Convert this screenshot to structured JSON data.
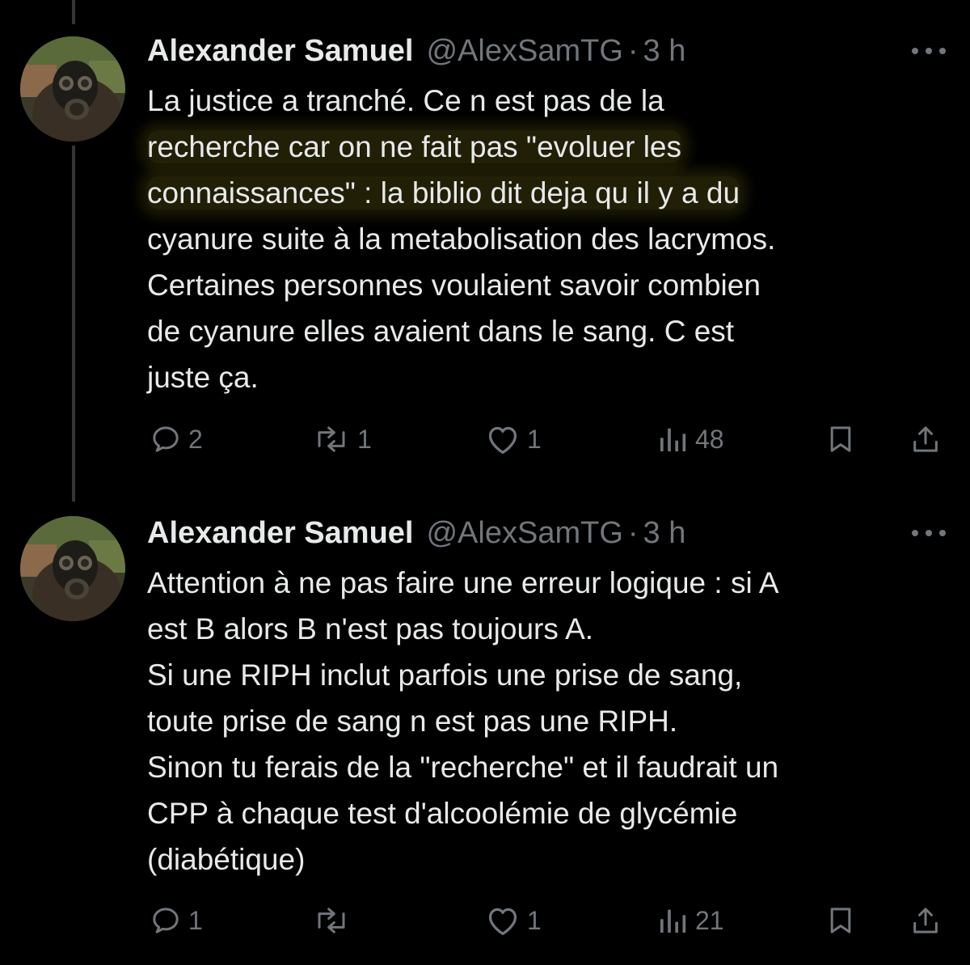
{
  "tweets": [
    {
      "author": "Alexander Samuel",
      "handle": "@AlexSamTG",
      "separator": "·",
      "time": "3 h",
      "lines": [
        "La justice a tranché. Ce n est pas de la",
        "recherche car on ne fait pas \"evoluer les",
        "connaissances\" : la biblio dit deja qu il y a du",
        "cyanure suite à la metabolisation des lacrymos.",
        "Certaines personnes voulaient savoir combien",
        "de cyanure elles avaient dans le sang. C est",
        "juste ça."
      ],
      "replies": "2",
      "retweets": "1",
      "likes": "1",
      "views": "48"
    },
    {
      "author": "Alexander Samuel",
      "handle": "@AlexSamTG",
      "separator": "·",
      "time": "3 h",
      "lines": [
        "Attention à ne pas faire une erreur logique : si A",
        "est B alors B n'est pas toujours A.",
        "Si une RIPH inclut parfois une prise de sang,",
        "toute prise de sang n est pas une RIPH.",
        "Sinon tu ferais de la \"recherche\" et il faudrait un",
        "CPP à chaque test d'alcoolémie de glycémie",
        "(diabétique)"
      ],
      "replies": "1",
      "retweets": "",
      "likes": "1",
      "views": "21"
    }
  ],
  "icons": {
    "reply": "reply-icon",
    "retweet": "retweet-icon",
    "like": "heart-icon",
    "views": "views-icon",
    "bookmark": "bookmark-icon",
    "share": "share-icon",
    "more": "more-icon"
  },
  "colors": {
    "background": "#000000",
    "text": "#e7e9ea",
    "secondary": "#71767b",
    "highlight": "#786e14"
  }
}
